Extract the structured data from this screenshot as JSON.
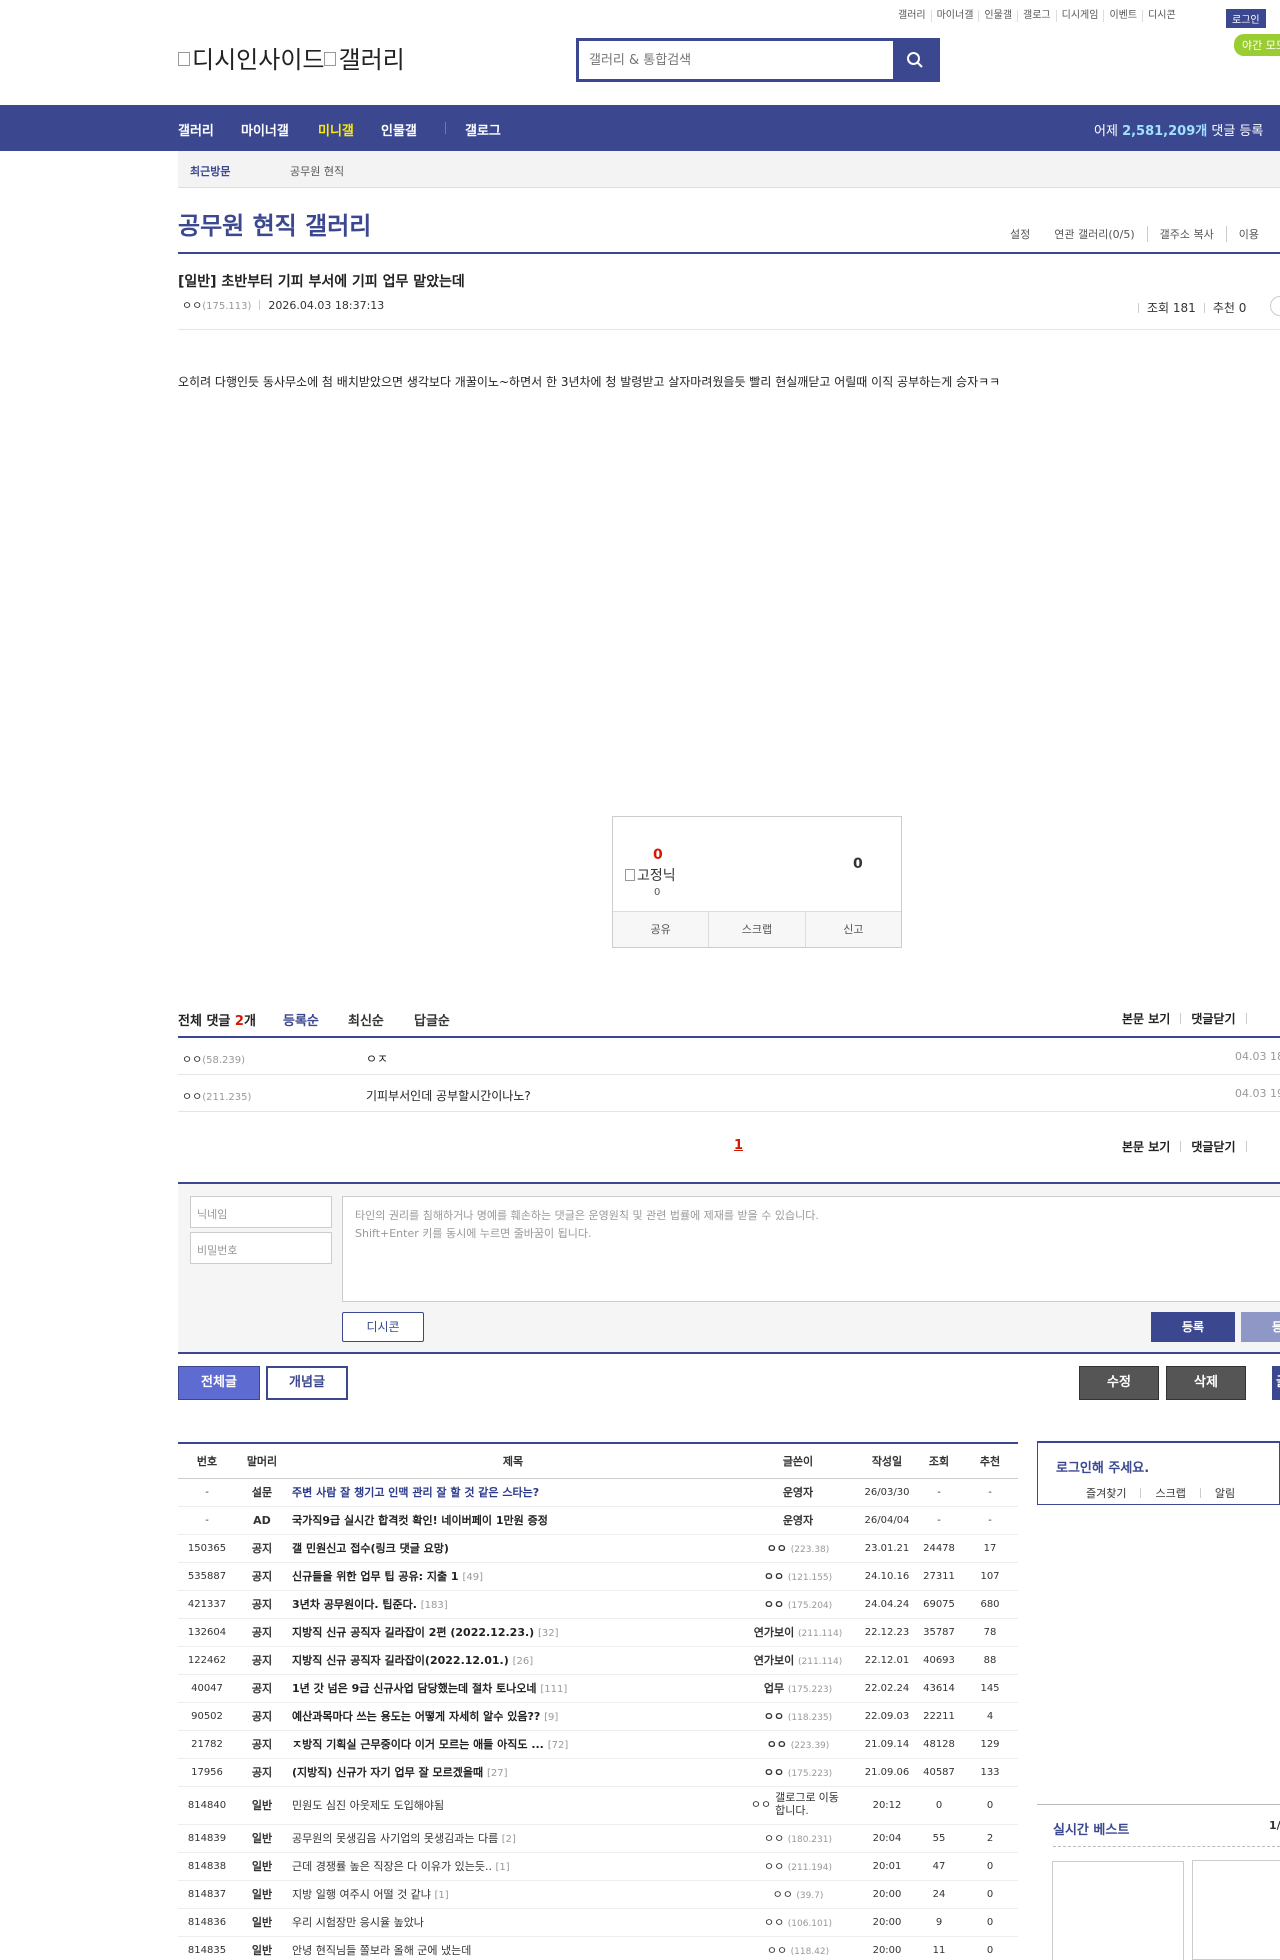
{
  "header": {
    "top_links": [
      "갤러리",
      "마이너갤",
      "인물갤",
      "갤로그",
      "디시게임",
      "이벤트",
      "디시콘"
    ],
    "login_label": "로그인",
    "night_mode_label": "야간 모드",
    "logo_text": "디시인사이드",
    "logo_sub_text": "갤러리",
    "search_placeholder": "갤러리 & 통합검색",
    "colors": {
      "brand": "#3b4890",
      "accent_yellow": "#ffea00",
      "red": "#d31900",
      "night_green": "#9acd32"
    }
  },
  "gnb": {
    "items": [
      "갤러리",
      "마이너갤",
      "미니갤",
      "인물갤",
      "갤로그"
    ],
    "active": "미니갤",
    "stat_prefix": "어제",
    "stat_value": "2,581,209개",
    "stat_suffix": "댓글 등록"
  },
  "visitbar": {
    "recent_label": "최근방문",
    "gallery_item": "공무원 현직"
  },
  "gallery": {
    "title": "공무원 현직 갤러리",
    "options": [
      "설정",
      "연관 갤러리(0/5)",
      "갤주소 복사",
      "이용"
    ]
  },
  "post": {
    "title": "[일반] 초반부터 기피 부서에 기피 업무 맡았는데",
    "author": "ㅇㅇ",
    "author_ip": "(175.113)",
    "datetime": "2026.04.03 18:37:13",
    "views_label": "조회 181",
    "recommend_label": "추천 0",
    "body": "오히려 다행인듯 동사무소에 첨 배치받았으면 생각보다 개꿀이노~하면서 한 3년차에 청 발령받고 살자마려웠을듯 빨리 현실깨닫고 어릴때 이직 공부하는게 승자ㅋㅋ",
    "recommend_up": "0",
    "fix_nick_alt": "고정닉",
    "fix_nick_count": "0",
    "recommend_down": "0",
    "actions": [
      "공유",
      "스크랩",
      "신고"
    ]
  },
  "comments": {
    "total_label": "전체 댓글",
    "count": "2",
    "count_unit": "개",
    "sorts": [
      "등록순",
      "최신순",
      "답글순"
    ],
    "view_body": "본문 보기",
    "close_comments": "댓글닫기",
    "items": [
      {
        "nick": "ㅇㅇ",
        "ip": "(58.239)",
        "text": "ㅇㅈ",
        "date": "04.03 18"
      },
      {
        "nick": "ㅇㅇ",
        "ip": "(211.235)",
        "text": "기피부서인데 공부할시간이나노?",
        "date": "04.03 19"
      }
    ],
    "page": "1"
  },
  "write": {
    "nick_placeholder": "닉네임",
    "pw_placeholder": "비밀번호",
    "notice_line1": "타인의 권리를 침해하거나 명예를 훼손하는 댓글은 운영원칙 및 관련 법률에 제재를 받을 수 있습니다.",
    "notice_line2": "Shift+Enter 키를 동시에 누르면 줄바꿈이 됩니다.",
    "dccon_label": "디시콘",
    "register_label": "등록",
    "register2_label": "등록"
  },
  "buttons": {
    "all": "전체글",
    "concept": "개념글",
    "edit": "수정",
    "delete": "삭제",
    "side": "글"
  },
  "list": {
    "headers": [
      "번호",
      "말머리",
      "제목",
      "글쓴이",
      "작성일",
      "조회",
      "추천"
    ],
    "rows": [
      {
        "num": "-",
        "head": "설문",
        "subject": "주변 사람 잘 챙기고 인맥 관리 잘 할 것 같은 스타는?",
        "reply": "",
        "writer": "운영자",
        "ip": "",
        "date": "26/03/30",
        "views": "-",
        "rec": "-",
        "type": "notice",
        "blue": true
      },
      {
        "num": "-",
        "head": "AD",
        "subject": "국가직9급 실시간 합격컷 확인! 네이버페이 1만원 증정",
        "reply": "",
        "writer": "운영자",
        "ip": "",
        "date": "26/04/04",
        "views": "-",
        "rec": "-",
        "type": "notice"
      },
      {
        "num": "150365",
        "head": "공지",
        "subject": "갤 민원신고 접수(링크 댓글 요망)",
        "reply": "",
        "writer": "ㅇㅇ",
        "ip": "(223.38)",
        "date": "23.01.21",
        "views": "24478",
        "rec": "17",
        "type": "notice"
      },
      {
        "num": "535887",
        "head": "공지",
        "subject": "신규들을 위한 업무 팁 공유: 지출 1",
        "reply": "[49]",
        "writer": "ㅇㅇ",
        "ip": "(121.155)",
        "date": "24.10.16",
        "views": "27311",
        "rec": "107",
        "type": "notice"
      },
      {
        "num": "421337",
        "head": "공지",
        "subject": "3년차 공무원이다. 팁준다.",
        "reply": "[183]",
        "writer": "ㅇㅇ",
        "ip": "(175.204)",
        "date": "24.04.24",
        "views": "69075",
        "rec": "680",
        "type": "notice"
      },
      {
        "num": "132604",
        "head": "공지",
        "subject": "지방직 신규 공직자 길라잡이 2편 (2022.12.23.)",
        "reply": "[32]",
        "writer": "연가보이",
        "ip": "(211.114)",
        "date": "22.12.23",
        "views": "35787",
        "rec": "78",
        "type": "notice"
      },
      {
        "num": "122462",
        "head": "공지",
        "subject": "지방직 신규 공직자 길라잡이(2022.12.01.)",
        "reply": "[26]",
        "writer": "연가보이",
        "ip": "(211.114)",
        "date": "22.12.01",
        "views": "40693",
        "rec": "88",
        "type": "notice"
      },
      {
        "num": "40047",
        "head": "공지",
        "subject": "1년 갓 넘은 9급 신규사업 담당했는데 절차 토나오네",
        "reply": "[111]",
        "writer": "업무",
        "ip": "(175.223)",
        "date": "22.02.24",
        "views": "43614",
        "rec": "145",
        "type": "notice"
      },
      {
        "num": "90502",
        "head": "공지",
        "subject": "예산과목마다 쓰는 용도는 어떻게 자세히 알수 있음??",
        "reply": "[9]",
        "writer": "ㅇㅇ",
        "ip": "(118.235)",
        "date": "22.09.03",
        "views": "22211",
        "rec": "4",
        "type": "notice"
      },
      {
        "num": "21782",
        "head": "공지",
        "subject": "ㅈ방직 기획실 근무중이다 이거 모르는 애들 아직도 ...",
        "reply": "[72]",
        "writer": "ㅇㅇ",
        "ip": "(223.39)",
        "date": "21.09.14",
        "views": "48128",
        "rec": "129",
        "type": "notice"
      },
      {
        "num": "17956",
        "head": "공지",
        "subject": "(지방직) 신규가 자기 업무 잘 모르겠을때",
        "reply": "[27]",
        "writer": "ㅇㅇ",
        "ip": "(175.223)",
        "date": "21.09.06",
        "views": "40587",
        "rec": "133",
        "type": "notice"
      },
      {
        "num": "814840",
        "head": "일반",
        "subject": "민원도 심진 아웃제도 도입해야됨",
        "reply": "",
        "writer": "ㅇㅇ",
        "ip": "",
        "writer_img_alt": "갤로그로 이동합니다.",
        "date": "20:12",
        "views": "0",
        "rec": "0",
        "type": "normal",
        "tall": true
      },
      {
        "num": "814839",
        "head": "일반",
        "subject": "공무원의 못생김음 사기업의 못생김과는 다름",
        "reply": "[2]",
        "writer": "ㅇㅇ",
        "ip": "(180.231)",
        "date": "20:04",
        "views": "55",
        "rec": "2",
        "type": "normal"
      },
      {
        "num": "814838",
        "head": "일반",
        "subject": "근데 경쟁률 높은 직장은 다 이유가 있는듯..",
        "reply": "[1]",
        "writer": "ㅇㅇ",
        "ip": "(211.194)",
        "date": "20:01",
        "views": "47",
        "rec": "0",
        "type": "normal"
      },
      {
        "num": "814837",
        "head": "일반",
        "subject": "지방 일행 여주시 어떨 것 같냐",
        "reply": "[1]",
        "writer": "ㅇㅇ",
        "ip": "(39.7)",
        "date": "20:00",
        "views": "24",
        "rec": "0",
        "type": "normal"
      },
      {
        "num": "814836",
        "head": "일반",
        "subject": "우리 시험장만 응시율 높았나",
        "reply": "",
        "writer": "ㅇㅇ",
        "ip": "(106.101)",
        "date": "20:00",
        "views": "9",
        "rec": "0",
        "type": "normal"
      },
      {
        "num": "814835",
        "head": "일반",
        "subject": "안녕 현직님들 쫄보라 올해 군에 냈는데",
        "reply": "",
        "writer": "ㅇㅇ",
        "ip": "(118.42)",
        "date": "20:00",
        "views": "11",
        "rec": "0",
        "type": "normal"
      }
    ]
  },
  "side": {
    "login_prompt": "로그인해 주세요.",
    "login_links": [
      "즐겨찾기",
      "스크랩",
      "알림"
    ],
    "best_title": "실시간 베스트",
    "best_page": "1/"
  }
}
